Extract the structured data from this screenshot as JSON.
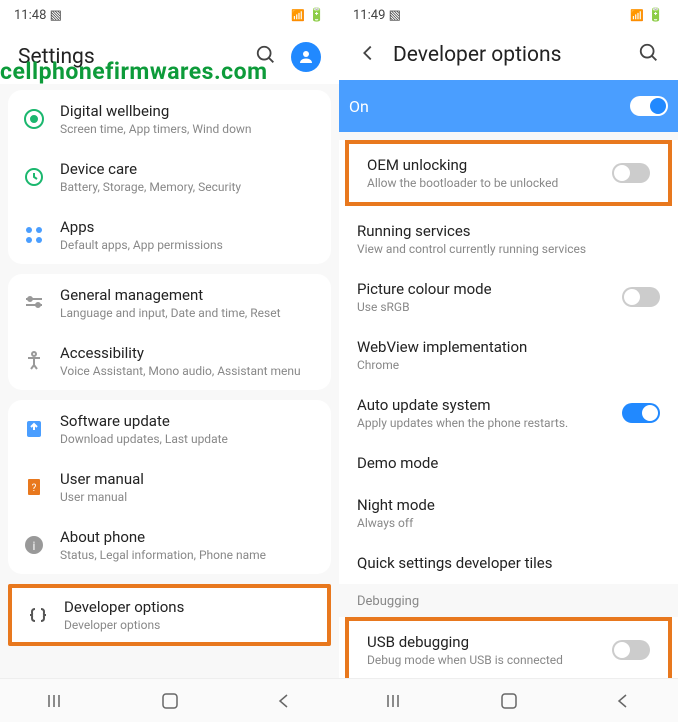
{
  "watermark": "cellphonefirmwares.com",
  "left": {
    "time": "11:48",
    "title": "Settings",
    "items": [
      {
        "title": "Digital wellbeing",
        "subtitle": "Screen time, App timers, Wind down",
        "icon": "wellbeing"
      },
      {
        "title": "Device care",
        "subtitle": "Battery, Storage, Memory, Security",
        "icon": "care"
      },
      {
        "title": "Apps",
        "subtitle": "Default apps, App permissions",
        "icon": "apps"
      },
      {
        "title": "General management",
        "subtitle": "Language and input, Date and time, Reset",
        "icon": "general"
      },
      {
        "title": "Accessibility",
        "subtitle": "Voice Assistant, Mono audio, Assistant menu",
        "icon": "accessibility"
      },
      {
        "title": "Software update",
        "subtitle": "Download updates, Last update",
        "icon": "update"
      },
      {
        "title": "User manual",
        "subtitle": "User manual",
        "icon": "manual"
      },
      {
        "title": "About phone",
        "subtitle": "Status, Legal information, Phone name",
        "icon": "about"
      },
      {
        "title": "Developer options",
        "subtitle": "Developer options",
        "icon": "developer",
        "highlighted": true
      }
    ]
  },
  "right": {
    "time": "11:49",
    "title": "Developer options",
    "master_toggle": "On",
    "items": [
      {
        "title": "OEM unlocking",
        "subtitle": "Allow the bootloader to be unlocked",
        "toggle": "off",
        "highlighted": true
      },
      {
        "title": "Running services",
        "subtitle": "View and control currently running services"
      },
      {
        "title": "Picture colour mode",
        "subtitle": "Use sRGB",
        "toggle": "off"
      },
      {
        "title": "WebView implementation",
        "subtitle": "Chrome"
      },
      {
        "title": "Auto update system",
        "subtitle": "Apply updates when the phone restarts.",
        "toggle": "on"
      },
      {
        "title": "Demo mode"
      },
      {
        "title": "Night mode",
        "subtitle": "Always off"
      },
      {
        "title": "Quick settings developer tiles"
      }
    ],
    "section_label": "Debugging",
    "usb_debug": {
      "title": "USB debugging",
      "subtitle": "Debug mode when USB is connected",
      "toggle": "off",
      "highlighted": true
    }
  }
}
